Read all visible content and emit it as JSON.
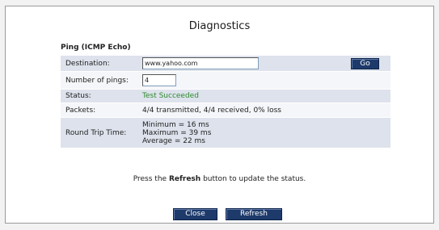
{
  "page": {
    "title": "Diagnostics",
    "section_title": "Ping (ICMP Echo)"
  },
  "form": {
    "destination_label": "Destination:",
    "destination_value": "www.yahoo.com",
    "go_label": "Go",
    "pings_label": "Number of pings:",
    "pings_value": "4",
    "status_label": "Status:",
    "status_value": "Test Succeeded",
    "packets_label": "Packets:",
    "packets_value": "4/4 transmitted, 4/4 received, 0% loss",
    "rtt_label": "Round Trip Time:",
    "rtt_min": "Minimum = 16 ms",
    "rtt_max": "Maximum = 39 ms",
    "rtt_avg": "Average = 22 ms"
  },
  "hint": {
    "before": "Press the ",
    "bold": "Refresh",
    "after": " button to update the status."
  },
  "buttons": {
    "close_label": "Close",
    "refresh_label": "Refresh"
  },
  "colors": {
    "button_bg": "#1d3a6b",
    "row_shade": "#dde2ec",
    "status_ok": "#2e8b2e"
  }
}
